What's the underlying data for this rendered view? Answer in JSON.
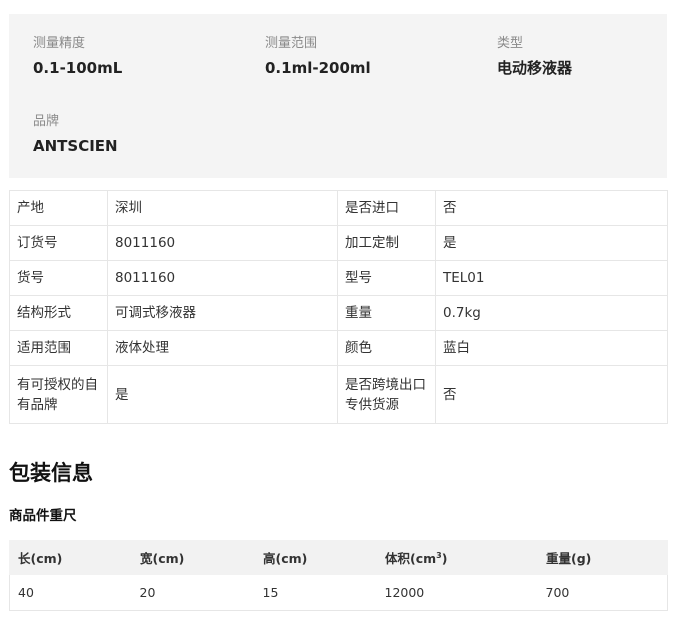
{
  "summary": {
    "items": [
      {
        "label": "测量精度",
        "value": "0.1-100mL"
      },
      {
        "label": "测量范围",
        "value": "0.1ml-200ml"
      },
      {
        "label": "类型",
        "value": "电动移液器"
      },
      {
        "label": "品牌",
        "value": "ANTSCIEN"
      }
    ]
  },
  "specs": {
    "rows": [
      {
        "k1": "产地",
        "v1": "深圳",
        "k2": "是否进口",
        "v2": "否"
      },
      {
        "k1": "订货号",
        "v1": "8011160",
        "k2": "加工定制",
        "v2": "是"
      },
      {
        "k1": "货号",
        "v1": "8011160",
        "k2": "型号",
        "v2": "TEL01"
      },
      {
        "k1": "结构形式",
        "v1": "可调式移液器",
        "k2": "重量",
        "v2": "0.7kg"
      },
      {
        "k1": "适用范围",
        "v1": "液体处理",
        "k2": "颜色",
        "v2": "蓝白"
      },
      {
        "k1": "有可授权的自有品牌",
        "v1": "是",
        "k2": "是否跨境出口专供货源",
        "v2": "否"
      }
    ]
  },
  "packaging": {
    "title": "包装信息",
    "subtitle": "商品件重尺",
    "headers": {
      "length": "长(cm)",
      "width": "宽(cm)",
      "height": "高(cm)",
      "volume_prefix": "体积(cm",
      "volume_sup": "3",
      "volume_suffix": ")",
      "weight": "重量(g)"
    },
    "row": {
      "length": "40",
      "width": "20",
      "height": "15",
      "volume": "12000",
      "weight": "700"
    }
  }
}
